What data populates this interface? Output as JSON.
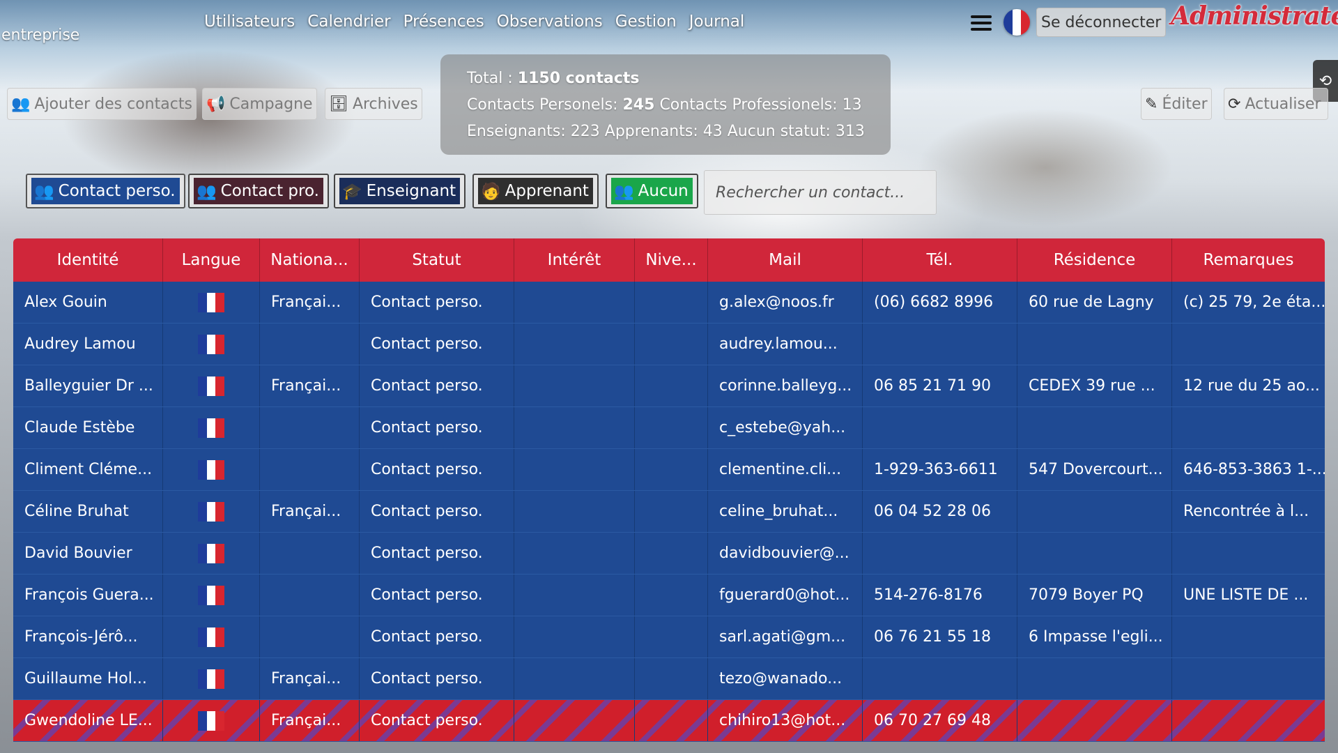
{
  "header": {
    "brand_subtitle": "entreprise",
    "nav": [
      "Utilisateurs",
      "Calendrier",
      "Présences",
      "Observations",
      "Gestion",
      "Journal"
    ],
    "logout_label": "Se déconnecter",
    "role_label": "Administrateur",
    "menu_icon": "hamburger-icon",
    "language_flag": "france-flag"
  },
  "colors": {
    "header_red": "#d0263a",
    "row_blue": "#1f4a93",
    "selected_row": "#d01f2b",
    "chip_green": "#1aa64a"
  },
  "toolbar": {
    "add_contacts": "Ajouter des contacts",
    "campaign": "Campagne",
    "archives": "Archives",
    "edit": "Éditer",
    "refresh": "Actualiser"
  },
  "stats": {
    "total_label": "Total :",
    "total_value": "1150 contacts",
    "personal_label": "Contacts Personels:",
    "personal_value": "245",
    "pro_label": "Contacts Professionels:",
    "pro_value": "13",
    "teachers_label": "Enseignants:",
    "teachers_value": "223",
    "learners_label": "Apprenants:",
    "learners_value": "43",
    "nostatus_label": "Aucun statut:",
    "nostatus_value": "313"
  },
  "filters": {
    "perso": "Contact perso.",
    "pro": "Contact pro.",
    "teacher": "Enseignant",
    "learner": "Apprenant",
    "none": "Aucun"
  },
  "search": {
    "placeholder": "Rechercher un contact..."
  },
  "table": {
    "columns": [
      "Identité",
      "Langue",
      "Nationa...",
      "Statut",
      "Intérêt",
      "Nive...",
      "Mail",
      "Tél.",
      "Résidence",
      "Remarques"
    ],
    "rows": [
      [
        "Alex Gouin",
        "",
        "Françai...",
        "Contact perso.",
        "",
        "",
        "g.alex@noos.fr",
        "(06) 6682 8996",
        "60 rue de Lagny",
        "(c) 25 79, 2e éta..."
      ],
      [
        "Audrey Lamou",
        "",
        "",
        "Contact perso.",
        "",
        "",
        "audrey.lamou...",
        "",
        "",
        ""
      ],
      [
        "Balleyguier Dr ...",
        "",
        "Françai...",
        "Contact perso.",
        "",
        "",
        "corinne.balleyg...",
        "06 85 21 71 90",
        "CEDEX 39 rue ...",
        "12 rue du 25 ao..."
      ],
      [
        "Claude Estèbe",
        "",
        "",
        "Contact perso.",
        "",
        "",
        "c_estebe@yah...",
        "",
        "",
        ""
      ],
      [
        "Climent Cléme...",
        "",
        "",
        "Contact perso.",
        "",
        "",
        "clementine.cli...",
        "1-929-363-6611",
        "547 Dovercourt...",
        "646-853-3863 1-..."
      ],
      [
        "Céline Bruhat",
        "",
        "Françai...",
        "Contact perso.",
        "",
        "",
        "celine_bruhat...",
        "06 04 52 28 06",
        "",
        "Rencontrée à l..."
      ],
      [
        "David Bouvier",
        "",
        "",
        "Contact perso.",
        "",
        "",
        "davidbouvier@...",
        "",
        "",
        ""
      ],
      [
        "François Guera...",
        "",
        "",
        "Contact perso.",
        "",
        "",
        "fguerard0@hot...",
        "514-276-8176",
        "7079 Boyer PQ",
        "UNE LISTE DE ..."
      ],
      [
        "François-Jérô...",
        "",
        "",
        "Contact perso.",
        "",
        "",
        "sarl.agati@gm...",
        "06 76 21 55 18",
        "6 Impasse l'egli...",
        ""
      ],
      [
        "Guillaume Hol...",
        "",
        "Françai...",
        "Contact perso.",
        "",
        "",
        "tezo@wanado...",
        "",
        "",
        ""
      ],
      [
        "Gwendoline LE...",
        "",
        "Françai...",
        "Contact perso.",
        "",
        "",
        "chihiro13@hot...",
        "06 70 27 69 48",
        "",
        ""
      ]
    ],
    "selected_row": 10
  }
}
